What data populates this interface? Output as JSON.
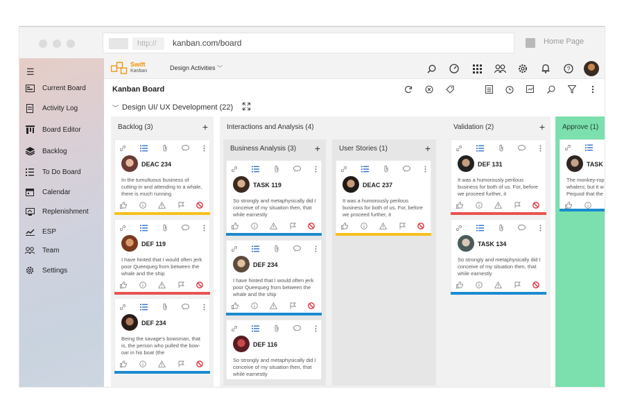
{
  "browser": {
    "protocol": "http://",
    "url": "kanban.com/board",
    "home_label": "Home Page"
  },
  "sidebar": {
    "items": [
      {
        "label": "Current Board",
        "icon": "board-icon"
      },
      {
        "label": "Activity Log",
        "icon": "document-icon"
      },
      {
        "label": "Board Editor",
        "icon": "board-editor-icon"
      },
      {
        "label": "Backlog",
        "icon": "layers-icon"
      },
      {
        "label": "To Do Board",
        "icon": "list-icon"
      },
      {
        "label": "Calendar",
        "icon": "calendar-icon"
      },
      {
        "label": "Replenishment",
        "icon": "replenishment-icon"
      },
      {
        "label": "ESP",
        "icon": "chart-icon"
      },
      {
        "label": "Team",
        "icon": "team-icon"
      },
      {
        "label": "Settings",
        "icon": "gear-icon"
      }
    ]
  },
  "appbar": {
    "logo_line1": "Swift",
    "logo_line2": "Kanban",
    "project": "Design Activities"
  },
  "board": {
    "title": "Kanban Board",
    "swimlane": "Design UI/ UX Development (22)"
  },
  "columns": {
    "backlog": {
      "title": "Backlog (3)",
      "cards": [
        {
          "title": "DEAC 234",
          "desc": "In the tumultuous business of cutting-in and attending to a whale, there is much running",
          "bar": "yellow"
        },
        {
          "title": "DEF 119",
          "desc": "I have hinted that I would often jerk poor Queequeg from between the whale and the ship",
          "bar": "red"
        },
        {
          "title": "DEF 234",
          "desc": "Being the savage's bowsman, that is, the person who pulled the bow-oar in his boat (the",
          "bar": "blue"
        }
      ]
    },
    "interactions": {
      "title": "Interactions and Analysis (4)",
      "business": {
        "title": "Business Analysis (3)",
        "cards": [
          {
            "title": "TASK 119",
            "desc": "So strongly and metaphysically did I conceive of my situation then, that while earnestly",
            "bar": "blue"
          },
          {
            "title": "DEF 234",
            "desc": "I have hinted that I would often jerk poor Queequeg from between the whale and the ship",
            "bar": "blue"
          },
          {
            "title": "DEF 116",
            "desc": "So strongly and metaphysically did I conceive of my situation then, that while earnestly",
            "bar": ""
          }
        ]
      },
      "stories": {
        "title": "User Stories (1)",
        "cards": [
          {
            "title": "DEAC 237",
            "desc": "It was a humorously perilous business for both of us. For, before we proceed further, it",
            "bar": "yellow"
          }
        ]
      }
    },
    "validation": {
      "title": "Validation (2)",
      "cards": [
        {
          "title": "DEF 131",
          "desc": "It was a humorously perilous business for both of us. For, before we proceed further, it",
          "bar": "red"
        },
        {
          "title": "TASK 134",
          "desc": "So strongly and metaphysically did I conceive of my situation then, that while earnestly",
          "bar": "blue"
        }
      ]
    },
    "approve": {
      "title": "Approve (1)",
      "cards": [
        {
          "title": "TASK",
          "desc": "The monkey-rop whalers; but it w Pequod that the"
        }
      ]
    }
  }
}
